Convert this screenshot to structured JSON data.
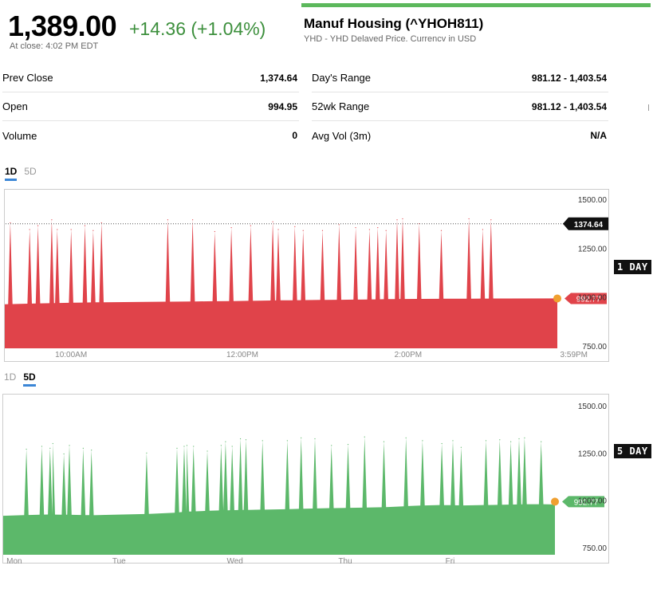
{
  "quote": {
    "price": "1,389.00",
    "change": "+14.36 (+1.04%)",
    "close_time": "At close: 4:02 PM EDT",
    "name": "Manuf Housing (^YHOH811)",
    "subtitle": "YHD - YHD Delaved Price. Currencv in USD"
  },
  "stats_left": [
    {
      "label": "Prev Close",
      "value": "1,374.64"
    },
    {
      "label": "Open",
      "value": "994.95"
    },
    {
      "label": "Volume",
      "value": "0"
    }
  ],
  "stats_right": [
    {
      "label": "Day's Range",
      "value": "981.12 - 1,403.54"
    },
    {
      "label": "52wk Range",
      "value": "981.12 - 1,403.54"
    },
    {
      "label": "Avg Vol (3m)",
      "value": "N/A"
    }
  ],
  "colors": {
    "down": "#e0434a",
    "up": "#5cb86a",
    "marker": "#f0a030",
    "accent": "#3b86d6"
  },
  "chart_data": [
    {
      "type": "area",
      "tabs": [
        {
          "label": "1D",
          "active": true
        },
        {
          "label": "5D",
          "active": false
        }
      ],
      "color": "#e0434a",
      "ylim": [
        750,
        1500
      ],
      "yticks": [
        750,
        1000,
        1250,
        1500
      ],
      "ytick_labels": [
        "750.00",
        "1000.00",
        "1250.00",
        "1500.00"
      ],
      "xtick_labels": [
        "10:00AM",
        "12:00PM",
        "2:00PM",
        "3:59PM"
      ],
      "xtick_pos": [
        0.12,
        0.43,
        0.73,
        1.03
      ],
      "reference_line": {
        "value": 1374.64,
        "label": "1374.64"
      },
      "last": {
        "value": 992.77,
        "label": "992.77"
      },
      "baseline": [
        963,
        968,
        972,
        975,
        976,
        978,
        980,
        983,
        985,
        987,
        990,
        991,
        992,
        993,
        992.77
      ],
      "spikes": [
        {
          "x": 0.01,
          "y": 1380
        },
        {
          "x": 0.045,
          "y": 1345
        },
        {
          "x": 0.06,
          "y": 1365
        },
        {
          "x": 0.085,
          "y": 1395
        },
        {
          "x": 0.095,
          "y": 1345
        },
        {
          "x": 0.12,
          "y": 1345
        },
        {
          "x": 0.145,
          "y": 1365
        },
        {
          "x": 0.16,
          "y": 1340
        },
        {
          "x": 0.175,
          "y": 1380
        },
        {
          "x": 0.295,
          "y": 1395
        },
        {
          "x": 0.34,
          "y": 1395
        },
        {
          "x": 0.38,
          "y": 1335
        },
        {
          "x": 0.41,
          "y": 1355
        },
        {
          "x": 0.445,
          "y": 1365
        },
        {
          "x": 0.485,
          "y": 1385
        },
        {
          "x": 0.495,
          "y": 1345
        },
        {
          "x": 0.525,
          "y": 1360
        },
        {
          "x": 0.54,
          "y": 1340
        },
        {
          "x": 0.575,
          "y": 1340
        },
        {
          "x": 0.605,
          "y": 1370
        },
        {
          "x": 0.635,
          "y": 1355
        },
        {
          "x": 0.66,
          "y": 1345
        },
        {
          "x": 0.675,
          "y": 1355
        },
        {
          "x": 0.69,
          "y": 1340
        },
        {
          "x": 0.71,
          "y": 1395
        },
        {
          "x": 0.72,
          "y": 1400
        },
        {
          "x": 0.75,
          "y": 1375
        },
        {
          "x": 0.79,
          "y": 1340
        },
        {
          "x": 0.84,
          "y": 1400
        },
        {
          "x": 0.865,
          "y": 1345
        },
        {
          "x": 0.88,
          "y": 1395
        }
      ]
    },
    {
      "type": "area",
      "tabs": [
        {
          "label": "1D",
          "active": false
        },
        {
          "label": "5D",
          "active": true
        }
      ],
      "color": "#5cb86a",
      "ylim": [
        750,
        1500
      ],
      "yticks": [
        750,
        1000,
        1250,
        1500
      ],
      "ytick_labels": [
        "750.00",
        "1000.00",
        "1250.00",
        "1500.00"
      ],
      "xtick_labels": [
        "Mon",
        "Tue",
        "Wed",
        "Thu",
        "Fri"
      ],
      "xtick_pos": [
        0.02,
        0.21,
        0.42,
        0.62,
        0.81
      ],
      "last": {
        "value": 992.77,
        "label": "992.77"
      },
      "baseline": [
        918,
        922,
        925,
        923,
        921,
        924,
        927,
        930,
        940,
        945,
        948,
        950,
        952,
        955,
        958,
        960,
        962,
        965,
        972,
        975,
        973,
        975,
        977,
        980,
        978
      ],
      "spikes": [
        {
          "x": 0.042,
          "y": 1270
        },
        {
          "x": 0.07,
          "y": 1285
        },
        {
          "x": 0.085,
          "y": 1275
        },
        {
          "x": 0.09,
          "y": 1300
        },
        {
          "x": 0.11,
          "y": 1245
        },
        {
          "x": 0.12,
          "y": 1290
        },
        {
          "x": 0.145,
          "y": 1275
        },
        {
          "x": 0.16,
          "y": 1265
        },
        {
          "x": 0.26,
          "y": 1250
        },
        {
          "x": 0.315,
          "y": 1275
        },
        {
          "x": 0.328,
          "y": 1285
        },
        {
          "x": 0.333,
          "y": 1290
        },
        {
          "x": 0.345,
          "y": 1285
        },
        {
          "x": 0.37,
          "y": 1260
        },
        {
          "x": 0.395,
          "y": 1290
        },
        {
          "x": 0.403,
          "y": 1310
        },
        {
          "x": 0.415,
          "y": 1285
        },
        {
          "x": 0.43,
          "y": 1325
        },
        {
          "x": 0.44,
          "y": 1320
        },
        {
          "x": 0.47,
          "y": 1315
        },
        {
          "x": 0.515,
          "y": 1315
        },
        {
          "x": 0.54,
          "y": 1330
        },
        {
          "x": 0.565,
          "y": 1325
        },
        {
          "x": 0.595,
          "y": 1290
        },
        {
          "x": 0.625,
          "y": 1295
        },
        {
          "x": 0.655,
          "y": 1335
        },
        {
          "x": 0.69,
          "y": 1310
        },
        {
          "x": 0.73,
          "y": 1330
        },
        {
          "x": 0.76,
          "y": 1315
        },
        {
          "x": 0.795,
          "y": 1300
        },
        {
          "x": 0.815,
          "y": 1315
        },
        {
          "x": 0.83,
          "y": 1280
        },
        {
          "x": 0.875,
          "y": 1315
        },
        {
          "x": 0.9,
          "y": 1320
        },
        {
          "x": 0.92,
          "y": 1310
        },
        {
          "x": 0.935,
          "y": 1325
        },
        {
          "x": 0.945,
          "y": 1330
        },
        {
          "x": 0.975,
          "y": 1310
        }
      ]
    }
  ],
  "badges": [
    "1 DAY",
    "5 DAY"
  ]
}
